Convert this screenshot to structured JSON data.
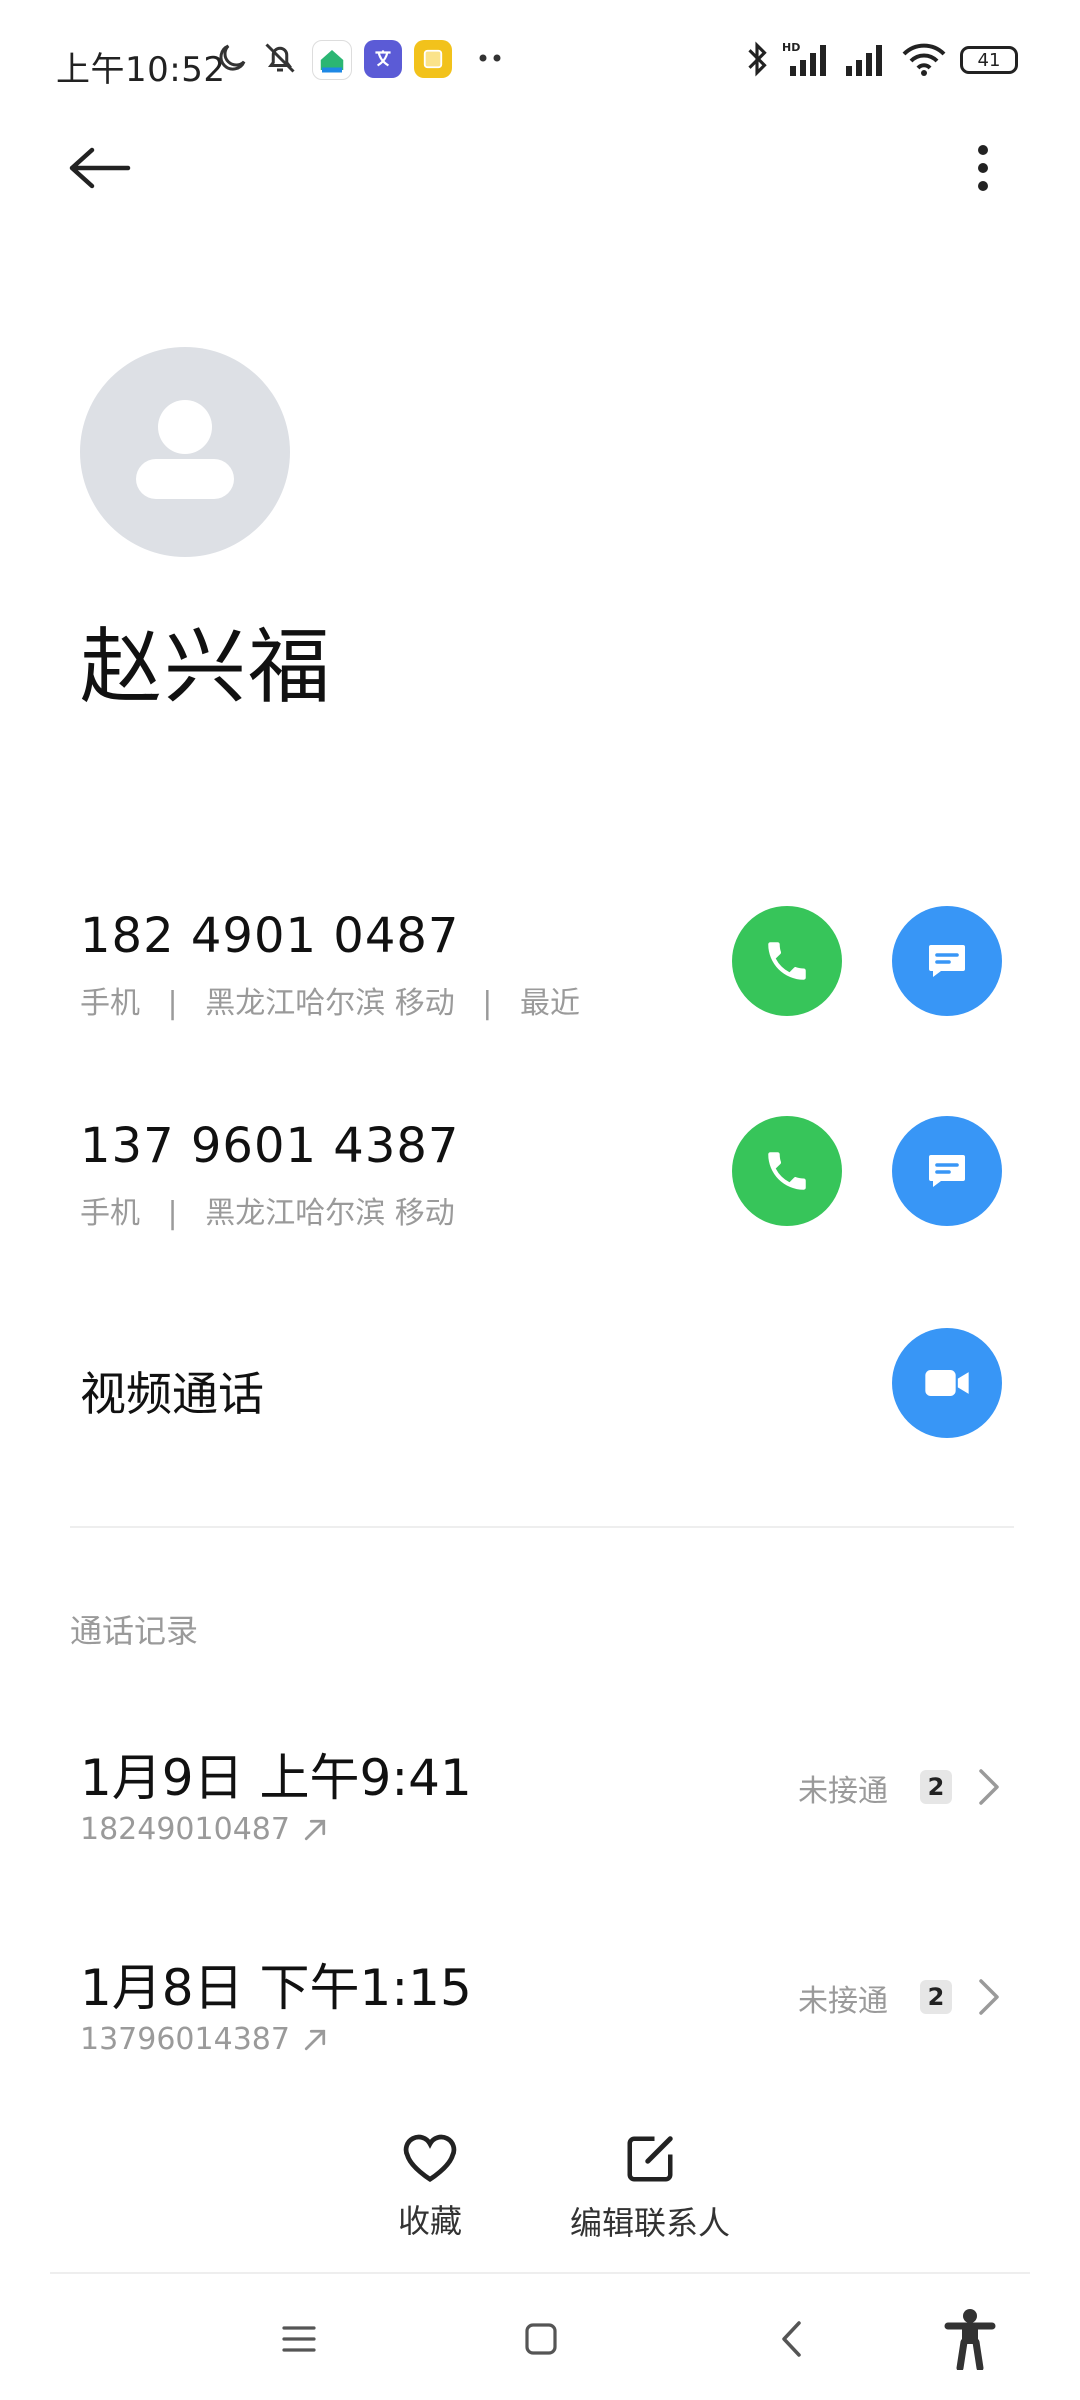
{
  "status_bar": {
    "time": "上午10:52",
    "battery": "41"
  },
  "contact": {
    "name": "赵兴福"
  },
  "phones": [
    {
      "number": "182 4901 0487",
      "type": "手机",
      "location": "黑龙江哈尔滨 移动",
      "recent": "最近",
      "sep": "|"
    },
    {
      "number": "137 9601 4387",
      "type": "手机",
      "location": "黑龙江哈尔滨 移动",
      "sep": "|"
    }
  ],
  "video_call": {
    "label": "视频通话"
  },
  "call_log": {
    "title": "通话记录",
    "entries": [
      {
        "datetime": "1月9日 上午9:41",
        "number": "18249010487",
        "status": "未接通",
        "count": "2"
      },
      {
        "datetime": "1月8日 下午1:15",
        "number": "13796014387",
        "status": "未接通",
        "count": "2"
      }
    ]
  },
  "actions": {
    "favorite": "收藏",
    "edit": "编辑联系人"
  },
  "colors": {
    "call_green": "#37c55a",
    "message_blue": "#3896f6",
    "avatar_bg": "#dde0e5"
  }
}
